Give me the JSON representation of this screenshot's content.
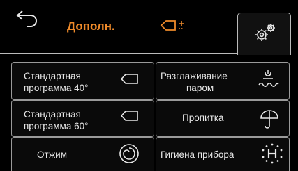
{
  "header": {
    "title": "Дополн.",
    "back_icon": "back-arrow-icon",
    "tag_icon": "program-tag-plus-minus-icon",
    "settings_icon": "settings-gears-icon",
    "accent_color": "#ee8a2a"
  },
  "options": [
    {
      "label_line1": "Стандартная",
      "label_line2": "программа 40°",
      "icon": "tag-icon"
    },
    {
      "label_line1": "Разглаживание",
      "label_line2": "паром",
      "icon": "steam-icon"
    },
    {
      "label_line1": "Стандартная",
      "label_line2": "программа 60°",
      "icon": "tag-icon"
    },
    {
      "label_line1": "Пропитка",
      "label_line2": "",
      "icon": "umbrella-icon"
    },
    {
      "label_line1": "Отжим",
      "label_line2": "",
      "icon": "spin-icon"
    },
    {
      "label_line1": "Гигиена прибора",
      "label_line2": "",
      "icon": "hygiene-icon"
    }
  ]
}
